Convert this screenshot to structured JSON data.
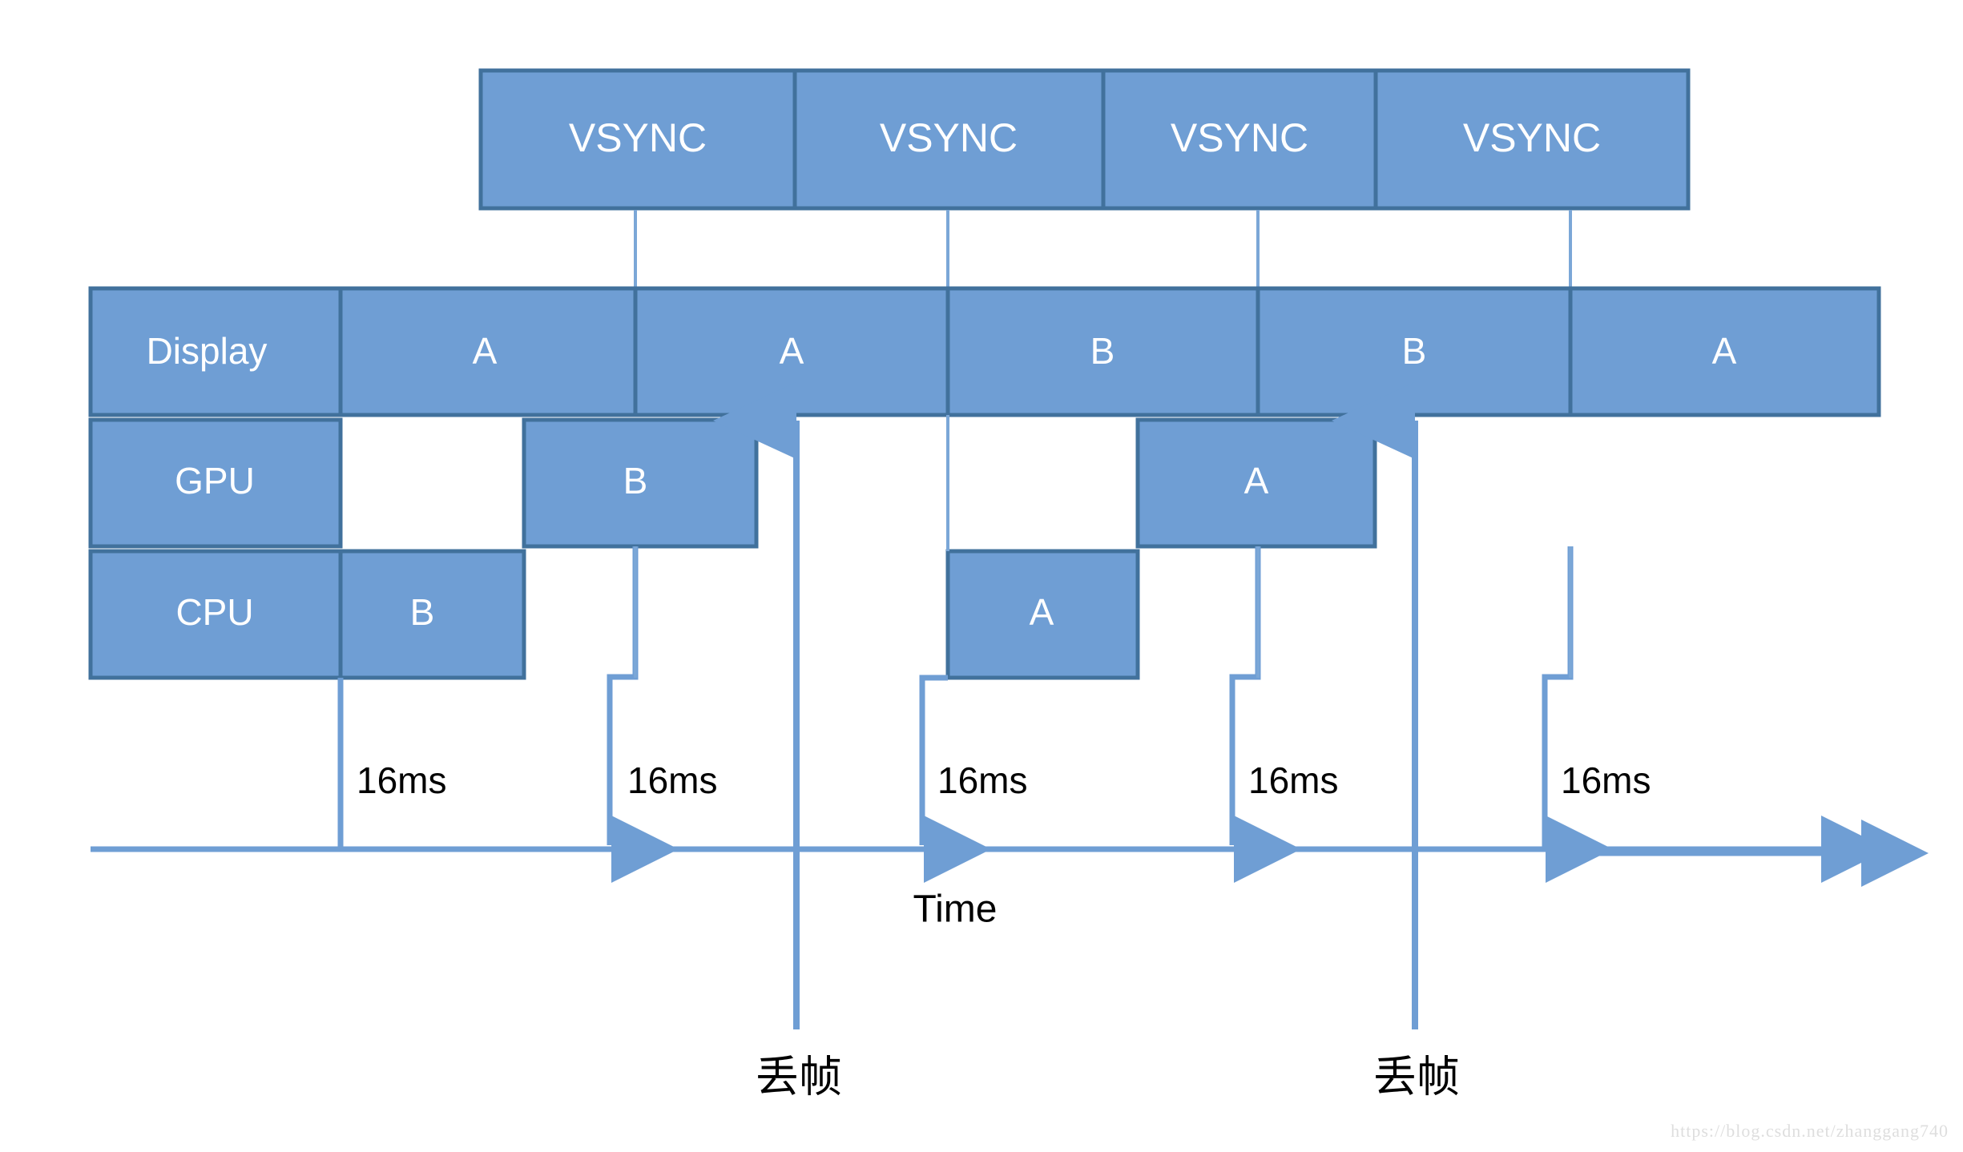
{
  "meta": {
    "title": "VSYNC / CPU / GPU / Display frame timing diagram",
    "watermark": "https://blog.csdn.net/zhanggang740"
  },
  "colors": {
    "fill": "#6f9ed4",
    "stroke": "#41719c",
    "line": "#6f9ed4",
    "thin_line": "#7ba7d7",
    "text_on_fill": "#ffffff",
    "text": "#000000",
    "background": "#ffffff",
    "watermark": "#dedede"
  },
  "vsync_row": {
    "label": "VSYNC",
    "boxes": [
      {
        "label": "VSYNC"
      },
      {
        "label": "VSYNC"
      },
      {
        "label": "VSYNC"
      },
      {
        "label": "VSYNC"
      }
    ]
  },
  "rows": {
    "display": {
      "label": "Display",
      "cells": [
        {
          "label": "A"
        },
        {
          "label": "A"
        },
        {
          "label": "B"
        },
        {
          "label": "B"
        },
        {
          "label": "A"
        }
      ]
    },
    "gpu": {
      "label": "GPU",
      "cells": [
        {
          "label": "B"
        },
        {
          "label": "A"
        }
      ]
    },
    "cpu": {
      "label": "CPU",
      "cells": [
        {
          "label": "B"
        },
        {
          "label": "A"
        }
      ]
    }
  },
  "timeline": {
    "axis_label": "Time",
    "intervals": [
      {
        "label": "16ms"
      },
      {
        "label": "16ms"
      },
      {
        "label": "16ms"
      },
      {
        "label": "16ms"
      },
      {
        "label": "16ms"
      }
    ]
  },
  "annotations": [
    {
      "label": "丢帧"
    },
    {
      "label": "丢帧"
    }
  ]
}
